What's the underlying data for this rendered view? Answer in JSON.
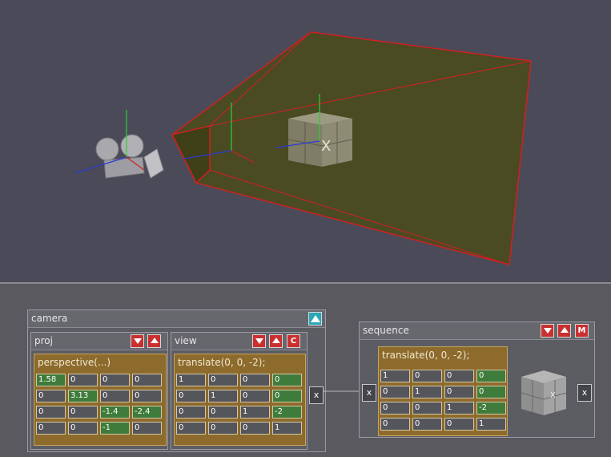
{
  "scene": {
    "cube_label": "X",
    "background_color": "#4b4a58",
    "frustum_fill": "#4a4a1a",
    "frustum_edge": "#d02020"
  },
  "camera_node": {
    "title": "camera",
    "collapse_icon": "triangle-up-icon",
    "proj": {
      "title": "proj",
      "matrix_title": "perspective(...)",
      "cells": [
        [
          "1.58",
          "0",
          "0",
          "0"
        ],
        [
          "0",
          "3.13",
          "0",
          "0"
        ],
        [
          "0",
          "0",
          "-1.4",
          "-2.4"
        ],
        [
          "0",
          "0",
          "-1",
          "0"
        ]
      ],
      "highlight": [
        [
          1,
          0,
          0,
          0
        ],
        [
          0,
          1,
          0,
          0
        ],
        [
          0,
          0,
          1,
          1
        ],
        [
          0,
          0,
          1,
          0
        ]
      ]
    },
    "view": {
      "title": "view",
      "btn_c": "C",
      "matrix_title": "translate(0, 0, -2);",
      "cells": [
        [
          "1",
          "0",
          "0",
          "0"
        ],
        [
          "0",
          "1",
          "0",
          "0"
        ],
        [
          "0",
          "0",
          "1",
          "-2"
        ],
        [
          "0",
          "0",
          "0",
          "1"
        ]
      ],
      "highlight": [
        [
          0,
          0,
          0,
          1
        ],
        [
          0,
          0,
          0,
          1
        ],
        [
          0,
          0,
          0,
          1
        ],
        [
          0,
          0,
          0,
          0
        ]
      ]
    },
    "x_button": "x"
  },
  "sequence_node": {
    "title": "sequence",
    "btn_m": "M",
    "in_x": "x",
    "out_x": "x",
    "matrix_title": "translate(0, 0, -2);",
    "cells": [
      [
        "1",
        "0",
        "0",
        "0"
      ],
      [
        "0",
        "1",
        "0",
        "0"
      ],
      [
        "0",
        "0",
        "1",
        "-2"
      ],
      [
        "0",
        "0",
        "0",
        "1"
      ]
    ],
    "highlight": [
      [
        0,
        0,
        0,
        1
      ],
      [
        0,
        0,
        0,
        1
      ],
      [
        0,
        0,
        0,
        1
      ],
      [
        0,
        0,
        0,
        0
      ]
    ],
    "thumb_label": "X"
  }
}
